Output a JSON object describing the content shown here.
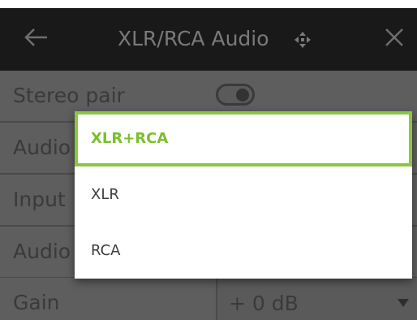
{
  "header": {
    "title": "XLR/RCA Audio",
    "back_icon": "arrow-left-icon",
    "move_icon": "move-arrows-icon",
    "close_icon": "close-icon"
  },
  "rows": [
    {
      "label": "Stereo pair",
      "control": "toggle",
      "toggle_on": true
    },
    {
      "label": "Audio"
    },
    {
      "label": "Input"
    },
    {
      "label": "Audio"
    },
    {
      "label": "Gain",
      "control": "select",
      "value": "+ 0 dB"
    }
  ],
  "dropdown": {
    "selected": "XLR+RCA",
    "options": [
      "XLR+RCA",
      "XLR",
      "RCA"
    ]
  },
  "colors": {
    "accent": "#8cc63f",
    "header_bg": "#191919",
    "overlay_bg": "#5e5e5e"
  }
}
